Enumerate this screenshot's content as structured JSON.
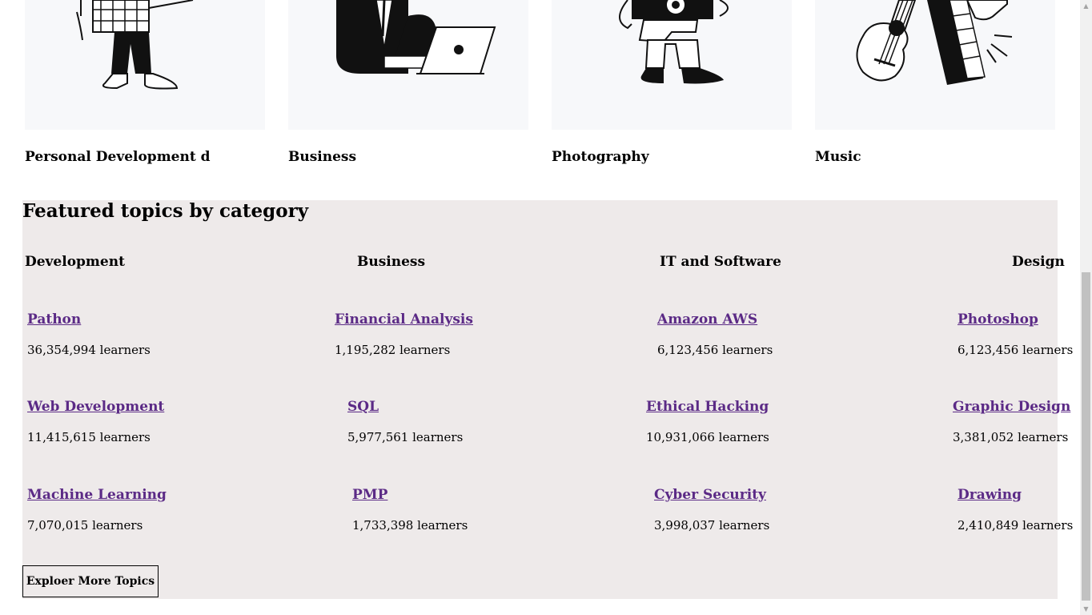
{
  "categories": [
    {
      "title": "Personal Development d",
      "illustration": "person-standing-illustration"
    },
    {
      "title": "Business",
      "illustration": "businessman-laptop-illustration"
    },
    {
      "title": "Photography",
      "illustration": "photographer-camera-illustration"
    },
    {
      "title": "Music",
      "illustration": "guitar-keyboard-illustration"
    }
  ],
  "featured": {
    "heading": "Featured topics by category",
    "columns": [
      {
        "name": "Development",
        "topics": [
          {
            "title": "Pathon",
            "learners": "36,354,994 learners"
          },
          {
            "title": "Web Development",
            "learners": "11,415,615 learners"
          },
          {
            "title": "Machine Learning",
            "learners": "7,070,015 learners"
          }
        ]
      },
      {
        "name": "Business",
        "topics": [
          {
            "title": "Financial Analysis",
            "learners": "1,195,282 learners"
          },
          {
            "title": "SQL",
            "learners": "5,977,561 learners"
          },
          {
            "title": "PMP",
            "learners": "1,733,398 learners"
          }
        ]
      },
      {
        "name": "IT and Software",
        "topics": [
          {
            "title": "Amazon AWS",
            "learners": "6,123,456 learners"
          },
          {
            "title": "Ethical Hacking",
            "learners": "10,931,066 learners"
          },
          {
            "title": "Cyber Security",
            "learners": "3,998,037 learners"
          }
        ]
      },
      {
        "name": "Design",
        "topics": [
          {
            "title": "Photoshop",
            "learners": "6,123,456 learners"
          },
          {
            "title": "Graphic Design",
            "learners": "3,381,052 learners"
          },
          {
            "title": "Drawing",
            "learners": "2,410,849 learners"
          }
        ]
      }
    ],
    "explore_label": "Exploer More Topics"
  },
  "colors": {
    "section_bg": "#eeeaea",
    "link": "#5b2a86",
    "card_bg": "#f7f8fa"
  }
}
